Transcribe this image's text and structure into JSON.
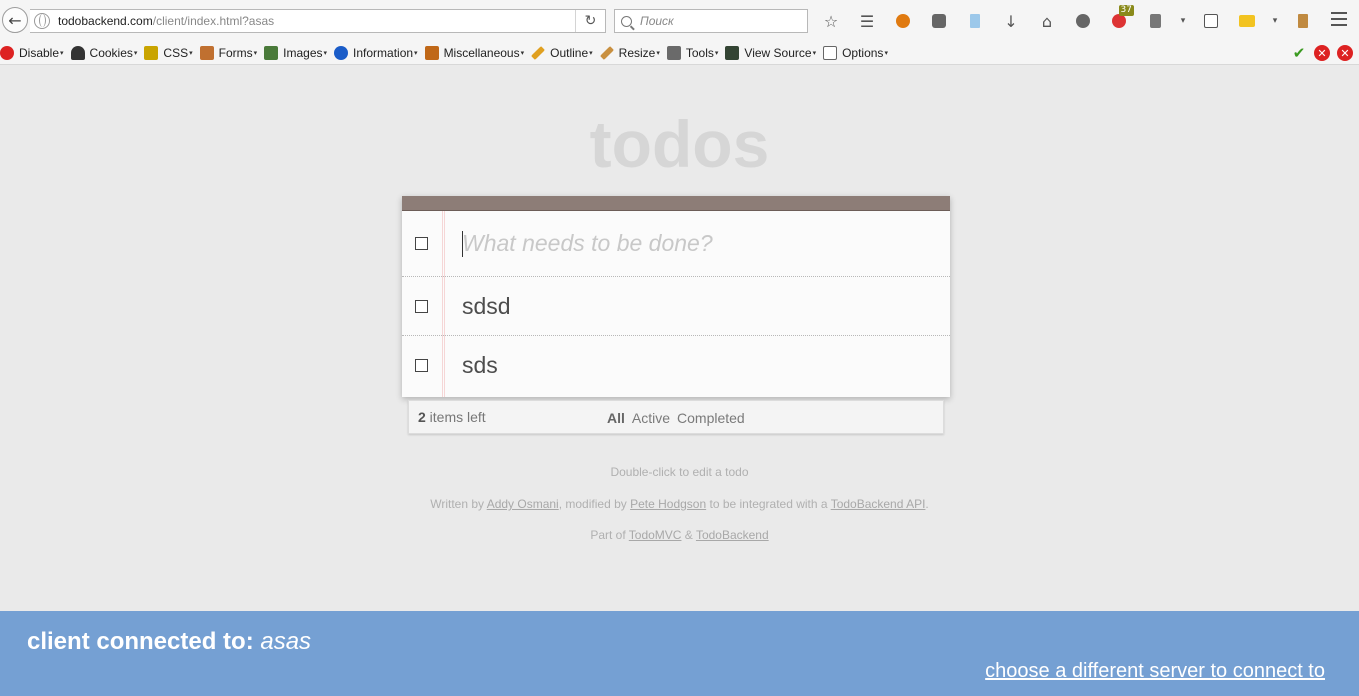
{
  "browser": {
    "url_host": "todobackend.com",
    "url_path": "/client/index.html?asas",
    "search_placeholder": "Поиск",
    "badge_count": "37",
    "toolbar_icons": [
      "bookmark-star-icon",
      "reading-list-icon",
      "avatar-icon",
      "pocket-icon",
      "bookmarks-icon",
      "download-icon",
      "home-icon",
      "chat-icon",
      "notifications-icon",
      "clipboard-icon",
      "dropdown-icon",
      "s-icon",
      "folder-icon",
      "dropdown-icon",
      "book-icon"
    ]
  },
  "devbar": {
    "items": [
      {
        "label": "Disable",
        "color": "#d22"
      },
      {
        "label": "Cookies",
        "color": "#333"
      },
      {
        "label": "CSS",
        "color": "#c9a400"
      },
      {
        "label": "Forms",
        "color": "#c07030"
      },
      {
        "label": "Images",
        "color": "#4a7a3a"
      },
      {
        "label": "Information",
        "color": "#1a5cc8"
      },
      {
        "label": "Miscellaneous",
        "color": "#c06818"
      },
      {
        "label": "Outline",
        "color": "#e0a020"
      },
      {
        "label": "Resize",
        "color": "#c99040"
      },
      {
        "label": "Tools",
        "color": "#6a6a6a"
      },
      {
        "label": "View Source",
        "color": "#334433"
      },
      {
        "label": "Options",
        "color": "#666"
      }
    ]
  },
  "app": {
    "title": "todos",
    "new_todo_placeholder": "What needs to be done?",
    "todos": [
      {
        "text": "sdsd",
        "completed": false
      },
      {
        "text": "sds",
        "completed": false
      }
    ],
    "footer": {
      "count": "2",
      "count_suffix": " items left",
      "filters": [
        "All",
        "Active",
        "Completed"
      ],
      "selected_filter": "All"
    },
    "info": {
      "hint": "Double-click to edit a todo",
      "written_prefix": "Written by ",
      "author": "Addy Osmani",
      "modified_prefix": ", modified by ",
      "modifier": "Pete Hodgson",
      "integrated_text": " to be integrated with a ",
      "api_link": "TodoBackend API",
      "period": ".",
      "part_of": "Part of ",
      "todomvc": "TodoMVC",
      "amp": " & ",
      "todobackend": "TodoBackend"
    }
  },
  "server": {
    "label": "client connected to: ",
    "name": "asas",
    "change_link": "choose a different server to connect to"
  }
}
